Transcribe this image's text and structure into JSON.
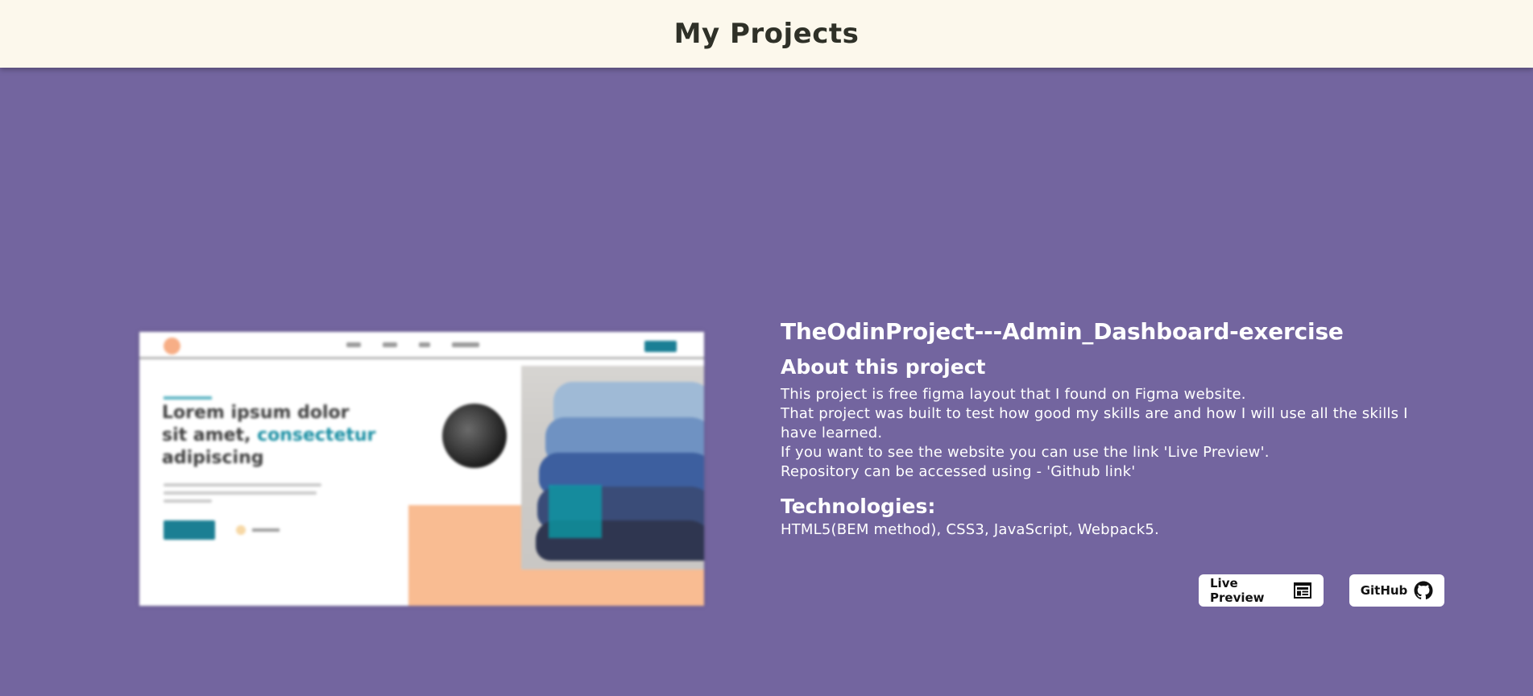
{
  "header": {
    "title": "My Projects"
  },
  "preview": {
    "heading_part1": "Lorem ipsum dolor sit amet,",
    "heading_accent": "consectetur",
    "heading_part2": "adipiscing"
  },
  "project": {
    "title": "TheOdinProject---Admin_Dashboard-exercise",
    "about_title": "About this project",
    "description": [
      "This project is free figma layout that I found on Figma website.",
      "That project was built to test how good my skills are and how I will use all the skills I have learned.",
      "If you want to see the website you can use the link 'Live Preview'.",
      "Repository can be accessed using - 'Github link'"
    ],
    "technologies_title": "Technologies:",
    "technologies": "HTML5(BEM method), CSS3, JavaScript, Webpack5."
  },
  "buttons": {
    "live_preview_label": "Live Preview",
    "live_preview_icon": "browser-window-icon",
    "github_label": "GitHub",
    "github_icon": "github-icon"
  },
  "colors": {
    "header_bg": "#fcf8ec",
    "page_bg": "#73659f",
    "text": "#ffffff"
  }
}
